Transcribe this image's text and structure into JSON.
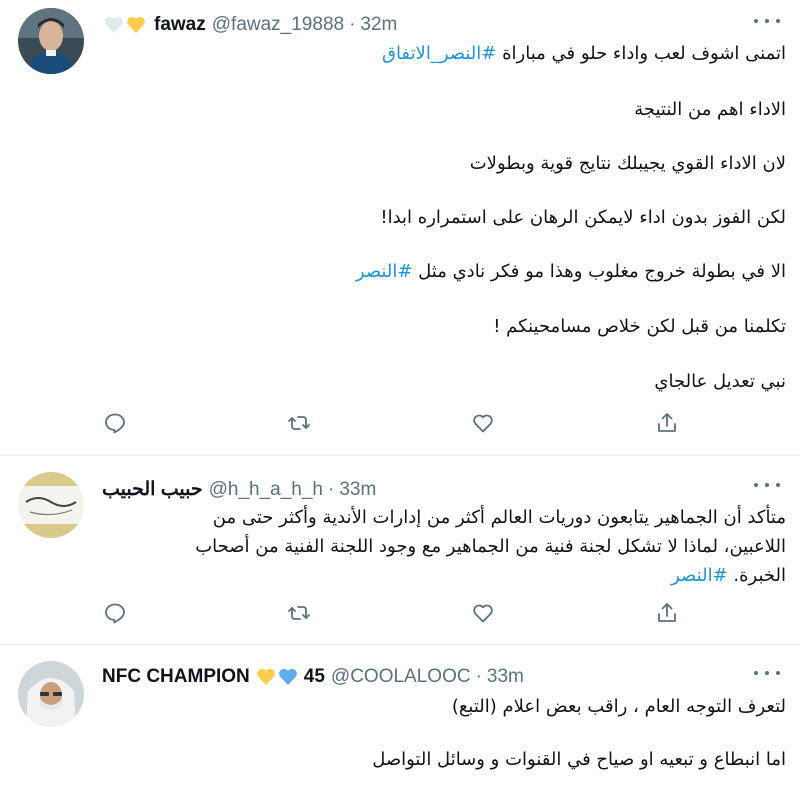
{
  "tweets": [
    {
      "name": "fawaz",
      "handle": "@fawaz_19888",
      "time": "32m",
      "hearts": [
        "#e1e8ed",
        "#ffcc4d"
      ],
      "lines": [
        {
          "text": "اتمنى اشوف لعب واداء حلو في مباراة ",
          "tag": "#النصر_الاتفاق"
        },
        {
          "text": "الاداء اهم من النتيجة"
        },
        {
          "text": "لان الاداء القوي يجيبلك نتايج قوية وبطولات"
        },
        {
          "text": "لكن الفوز بدون اداء لايمكن الرهان على استمراره ابدا!"
        },
        {
          "text": "الا في بطولة خروج مغلوب وهذا مو فكر نادي مثل ",
          "tag": "#النصر"
        },
        {
          "text": "تكلمنا من قبل لكن خلاص مسامحينكم !"
        },
        {
          "text": "نبي تعديل عالجاي"
        }
      ]
    },
    {
      "name": "حبيب الحبيب",
      "handle": "@h_h_a_h_h",
      "time": "33m",
      "avatar_text": "وَلَا تَيْأَسُوا مِن رَّوْحِ اللَّهِ",
      "lines": [
        {
          "text": "متأكد أن الجماهير يتابعون دوريات العالم أكثر من إدارات الأندية وأكثر حتى من"
        },
        {
          "text": "اللاعبين، لماذا لا تشكل لجنة فنية من الجماهير مع وجود اللجنة الفنية من أصحاب"
        },
        {
          "text": "الخبرة. ",
          "tag": "#النصر"
        }
      ]
    },
    {
      "name": "NFC CHAMPION",
      "suffix": "45",
      "handle": "@COOLALOOC",
      "time": "33m",
      "hearts": [
        "#ffcc4d",
        "#5dadec"
      ],
      "lines": [
        {
          "text": "لتعرف التوجه العام ، راقب بعض اعلام (التبع)"
        },
        {
          "text": "اما انبطاع و تبعيه او صياح في القنوات و وسائل التواصل"
        }
      ]
    }
  ],
  "colors": {
    "hashtag": "#1b95e0",
    "meta": "#5b7083"
  }
}
